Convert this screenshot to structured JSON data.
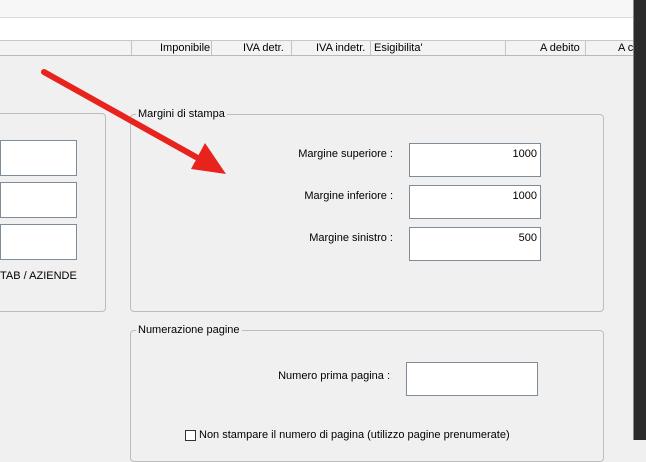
{
  "table_header": {
    "columns": [
      "Imponibile",
      "IVA detr.",
      "IVA indetr.",
      "Esigibilita'",
      "A debito",
      "A c"
    ]
  },
  "left_panel": {
    "label": "TAB / AZIENDE"
  },
  "margins": {
    "legend": "Margini di stampa",
    "top_label": "Margine superiore :",
    "top_value": "1000",
    "bottom_label": "Margine inferiore :",
    "bottom_value": "1000",
    "left_label": "Margine sinistro :",
    "left_value": "500"
  },
  "numbering": {
    "legend": "Numerazione pagine",
    "first_page_label": "Numero prima pagina :",
    "first_page_value": "",
    "no_print_label": "Non stampare il numero di pagina (utilizzo pagine prenumerate)"
  },
  "colors": {
    "annotation_arrow": "#e8231e"
  },
  "icons": {
    "arrow": "annotation-arrow-icon"
  }
}
